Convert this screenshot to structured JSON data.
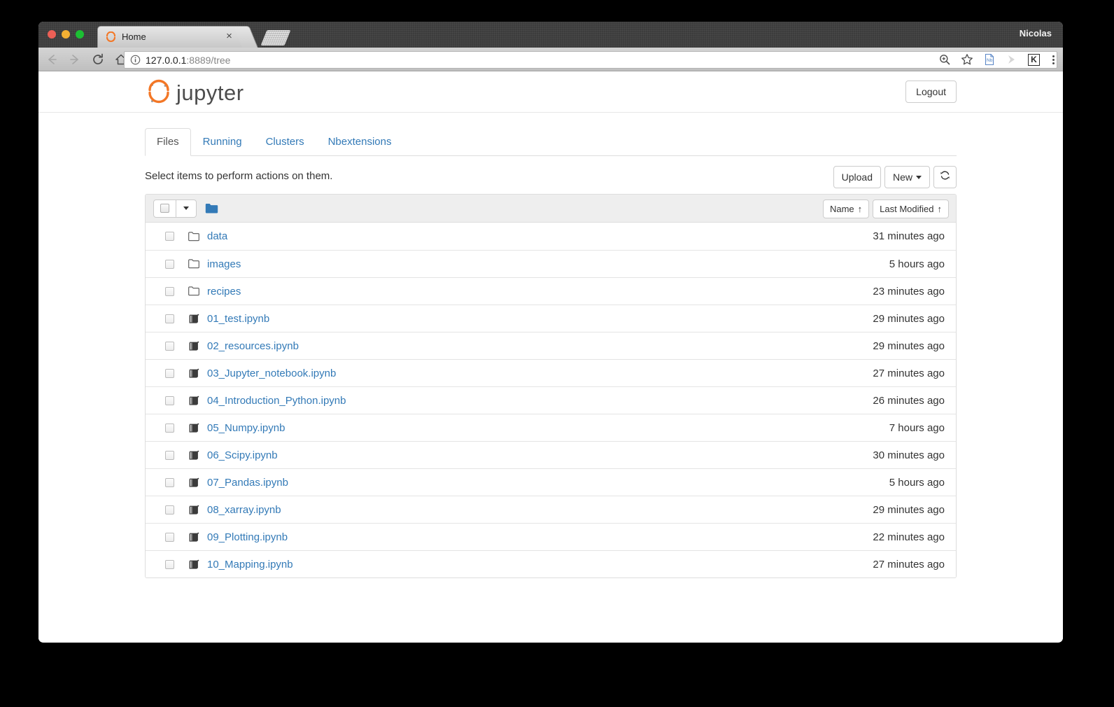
{
  "window": {
    "profile_name": "Nicolas",
    "tab_title": "Home",
    "tab_close_glyph": "×",
    "url_host": "127.0.0.1",
    "url_rest": ":8889/tree"
  },
  "jupyter": {
    "brand": "jupyter",
    "logout_label": "Logout",
    "tabs": [
      {
        "label": "Files",
        "active": true
      },
      {
        "label": "Running",
        "active": false
      },
      {
        "label": "Clusters",
        "active": false
      },
      {
        "label": "Nbextensions",
        "active": false
      }
    ],
    "action_text": "Select items to perform actions on them.",
    "upload_label": "Upload",
    "new_label": "New",
    "sort_name_label": "Name",
    "sort_modified_label": "Last Modified",
    "sort_arrow": "↑",
    "files": [
      {
        "name": "data",
        "type": "folder",
        "modified": "31 minutes ago"
      },
      {
        "name": "images",
        "type": "folder",
        "modified": "5 hours ago"
      },
      {
        "name": "recipes",
        "type": "folder",
        "modified": "23 minutes ago"
      },
      {
        "name": "01_test.ipynb",
        "type": "notebook",
        "modified": "29 minutes ago"
      },
      {
        "name": "02_resources.ipynb",
        "type": "notebook",
        "modified": "29 minutes ago"
      },
      {
        "name": "03_Jupyter_notebook.ipynb",
        "type": "notebook",
        "modified": "27 minutes ago"
      },
      {
        "name": "04_Introduction_Python.ipynb",
        "type": "notebook",
        "modified": "26 minutes ago"
      },
      {
        "name": "05_Numpy.ipynb",
        "type": "notebook",
        "modified": "7 hours ago"
      },
      {
        "name": "06_Scipy.ipynb",
        "type": "notebook",
        "modified": "30 minutes ago"
      },
      {
        "name": "07_Pandas.ipynb",
        "type": "notebook",
        "modified": "5 hours ago"
      },
      {
        "name": "08_xarray.ipynb",
        "type": "notebook",
        "modified": "29 minutes ago"
      },
      {
        "name": "09_Plotting.ipynb",
        "type": "notebook",
        "modified": "22 minutes ago"
      },
      {
        "name": "10_Mapping.ipynb",
        "type": "notebook",
        "modified": "27 minutes ago"
      }
    ]
  },
  "colors": {
    "link": "#337ab7",
    "jupyter_orange": "#f37726",
    "folder_blue": "#337ab7",
    "header_grey": "#eeeeee"
  },
  "icons": {
    "browser_back": "back-arrow-icon",
    "browser_forward": "forward-arrow-icon",
    "browser_reload": "reload-icon",
    "browser_home": "home-icon",
    "omnibox_info": "info-circle-icon",
    "omnibox_zoom": "zoom-icon",
    "omnibox_star": "star-icon",
    "ext_nb": "nbextension-icon",
    "ext_arrow": "grey-arrow-icon",
    "ext_k": "k-extension-icon",
    "menu": "kebab-menu-icon",
    "refresh": "refresh-icon",
    "folder": "folder-icon",
    "notebook": "notebook-book-icon"
  }
}
